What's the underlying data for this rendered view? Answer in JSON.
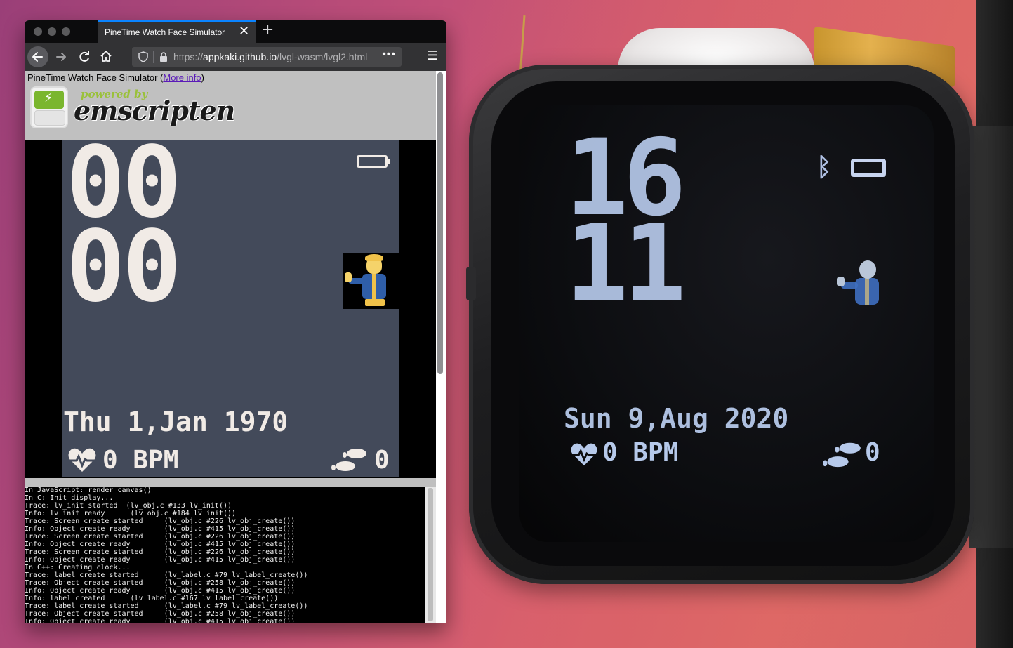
{
  "browser": {
    "tab_title": "PineTime Watch Face Simulator",
    "tab_close": "✕",
    "new_tab": "+",
    "url_prefix": "https://",
    "url_domain": "appkaki.github.io",
    "url_path": "/lvgl-wasm/lvgl2.html",
    "url_more": "•••",
    "menu": "☰"
  },
  "page": {
    "title": "PineTime Watch Face Simulator  (",
    "more_info": "More info",
    "title_end": ")",
    "powered_by": "powered by",
    "emscripten": "emscripten"
  },
  "simulator": {
    "hours": "00",
    "minutes": "00",
    "date": "Thu 1,Jan 1970",
    "bpm": "0 BPM",
    "steps": "0",
    "background_color": "#434a5a",
    "text_color": "#f1ebe6"
  },
  "console": {
    "lines": [
      "In JavaScript: render_canvas()",
      "In C: Init display...",
      "Trace: lv_init started  (lv_obj.c #133 lv_init())",
      "Info: lv_init ready      (lv_obj.c #184 lv_init())",
      "Trace: Screen create started     (lv_obj.c #226 lv_obj_create())",
      "Info: Object create ready        (lv_obj.c #415 lv_obj_create())",
      "Trace: Screen create started     (lv_obj.c #226 lv_obj_create())",
      "Info: Object create ready        (lv_obj.c #415 lv_obj_create())",
      "Trace: Screen create started     (lv_obj.c #226 lv_obj_create())",
      "Info: Object create ready        (lv_obj.c #415 lv_obj_create())",
      "In C++: Creating clock...",
      "Trace: label create started      (lv_label.c #79 lv_label_create())",
      "Trace: Object create started     (lv_obj.c #258 lv_obj_create())",
      "Info: Object create ready        (lv_obj.c #415 lv_obj_create())",
      "Info: label created      (lv_label.c #167 lv_label_create())",
      "Trace: label create started      (lv_label.c #79 lv_label_create())",
      "Trace: Object create started     (lv_obj.c #258 lv_obj_create())",
      "Info: Object create ready        (lv_obj.c #415 lv_obj_create())"
    ]
  },
  "real_watch": {
    "hours": "16",
    "minutes": "11",
    "date": "Sun 9,Aug 2020",
    "bpm": "0 BPM",
    "steps": "0",
    "text_color": "#b6c9ea"
  },
  "icons": {
    "back": "back-arrow-icon",
    "forward": "forward-arrow-icon",
    "reload": "reload-icon",
    "home": "home-icon",
    "shield": "shield-icon",
    "lock": "lock-icon",
    "heart": "heart-icon",
    "steps": "footsteps-icon",
    "battery": "battery-icon",
    "bluetooth": "bluetooth-icon"
  }
}
